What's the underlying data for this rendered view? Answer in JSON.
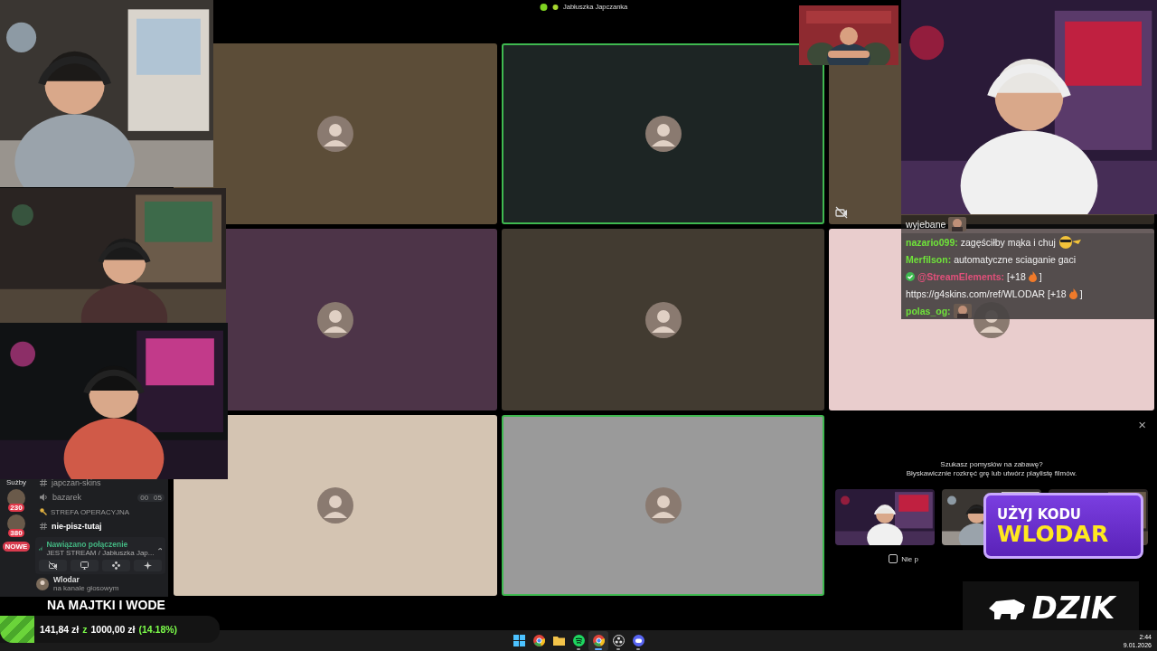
{
  "call": {
    "title": "Jabłuszka Japczanka",
    "tiles": [
      {
        "color": "#5c4d38",
        "speaking": false,
        "camera_off": false
      },
      {
        "color": "#1d2524",
        "speaking": true,
        "camera_off": false
      },
      {
        "color": "#5a4c3a",
        "speaking": false,
        "camera_off": true
      },
      {
        "color": "#4d3448",
        "speaking": false,
        "camera_off": false
      },
      {
        "color": "#423b31",
        "speaking": false,
        "camera_off": false
      },
      {
        "color": "#e9cdcd",
        "speaking": false,
        "camera_off": false
      },
      {
        "color": "#d4c4b2",
        "speaking": false,
        "camera_off": false
      },
      {
        "color": "#9a9a9a",
        "speaking": true,
        "camera_off": false
      }
    ]
  },
  "chat": {
    "lines": [
      {
        "segments": [
          {
            "kind": "text",
            "text": "wyjebane"
          },
          {
            "kind": "emote"
          }
        ]
      },
      {
        "segments": [
          {
            "kind": "user",
            "text": "nazario099:",
            "color": "#6fe23a"
          },
          {
            "kind": "text",
            "text": "zagęściłby mąka i chuj"
          },
          {
            "kind": "sunglasses"
          }
        ]
      },
      {
        "segments": [
          {
            "kind": "user",
            "text": "Merfilson:",
            "color": "#6fe23a"
          },
          {
            "kind": "text",
            "text": "automatyczne sciaganie gaci"
          }
        ]
      },
      {
        "segments": [
          {
            "kind": "badge"
          },
          {
            "kind": "user",
            "text": "@StreamElements:",
            "color": "#e0507a"
          },
          {
            "kind": "text",
            "text": "[+18"
          },
          {
            "kind": "fire"
          },
          {
            "kind": "text",
            "text": "]"
          }
        ]
      },
      {
        "segments": [
          {
            "kind": "text",
            "text": "https://g4skins.com/ref/WLODAR [+18"
          },
          {
            "kind": "fire"
          },
          {
            "kind": "text",
            "text": "]"
          }
        ]
      },
      {
        "segments": [
          {
            "kind": "user",
            "text": "polas_og:",
            "color": "#6fe23a"
          },
          {
            "kind": "emote"
          }
        ]
      }
    ]
  },
  "discord": {
    "servers_label": "Sużby",
    "servers": [
      {
        "badge": "230"
      },
      {
        "badge": "380"
      }
    ],
    "new_label": "NOWE",
    "channels": [
      {
        "kind": "text",
        "name": "japczan-skins",
        "unread": false
      },
      {
        "kind": "voice",
        "name": "bazarek",
        "unread": false,
        "counts": [
          "00",
          "05"
        ]
      },
      {
        "kind": "category",
        "name": "STREFA OPERACYJNA"
      },
      {
        "kind": "text",
        "name": "nie-pisz-tutaj",
        "unread": true
      }
    ],
    "voice": {
      "status": "Nawiązano połączenie",
      "channel": "JEST STREAM / Jabłuszka Jap..."
    },
    "user": {
      "name": "Wlodar",
      "status": "na kanale głosowym"
    }
  },
  "goal": {
    "title": "NA MAJTKI I WODE",
    "raised": "141,84 zł",
    "separator": "z",
    "target": "1000,00 zł",
    "percent": "(14.18%)",
    "level": 0.1418
  },
  "activity": {
    "close": "×",
    "heading": "Szukasz pomysłów na zabawę?",
    "subheading": "Błyskawicznie rozkręć grę lub utwórz playlistę filmów.",
    "checkbox": {
      "label": "Nie p",
      "checked": false
    }
  },
  "promo": {
    "line1": "UŻYJ KODU",
    "line2": "WLODAR"
  },
  "brand": {
    "name": "DZIK"
  },
  "taskbar": {
    "apps": [
      {
        "kind": "start",
        "running": false,
        "active": false
      },
      {
        "kind": "browser",
        "running": false,
        "active": false
      },
      {
        "kind": "folder",
        "running": false,
        "active": false
      },
      {
        "kind": "music",
        "running": true,
        "active": false
      },
      {
        "kind": "browser",
        "running": true,
        "active": true
      },
      {
        "kind": "recorder",
        "running": true,
        "active": false
      },
      {
        "kind": "chat",
        "running": true,
        "active": false
      }
    ],
    "time": "2:44",
    "date": "9.01.2026"
  }
}
